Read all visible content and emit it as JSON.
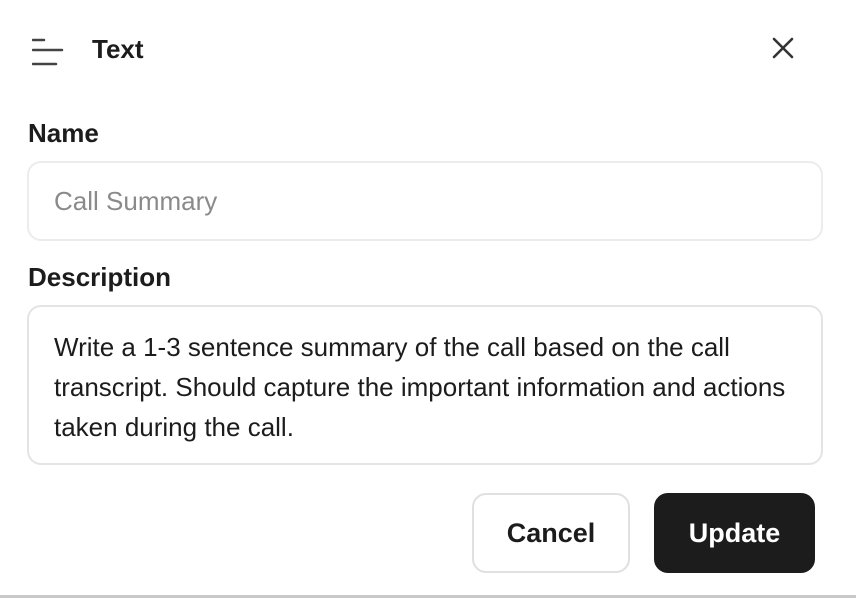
{
  "dialog": {
    "title": "Text",
    "type_icon": "text-lines-icon",
    "close_icon": "close-icon"
  },
  "form": {
    "name_label": "Name",
    "name_value": "",
    "name_placeholder": "Call Summary",
    "description_label": "Description",
    "description_value": "Write a 1-3 sentence summary of the call based on the call transcript. Should capture the important information and actions taken during the call."
  },
  "actions": {
    "cancel_label": "Cancel",
    "update_label": "Update"
  },
  "colors": {
    "primary_button": "#1c1c1c",
    "border": "#e4e4e4",
    "placeholder": "#8a8a8a"
  }
}
